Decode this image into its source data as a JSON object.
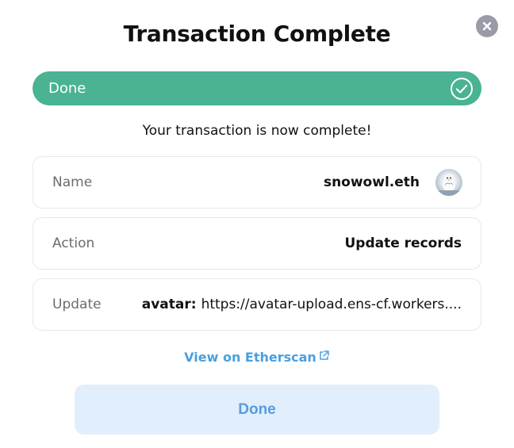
{
  "modal": {
    "title": "Transaction Complete",
    "status_label": "Done",
    "status_color": "#49b393",
    "subtitle": "Your transaction is now complete!"
  },
  "details": {
    "name": {
      "label": "Name",
      "value": "snowowl.eth",
      "icon": "owl-avatar"
    },
    "action": {
      "label": "Action",
      "value": "Update records"
    },
    "update": {
      "label": "Update",
      "key": "avatar:",
      "value": "https://avatar-upload.ens-cf.workers...."
    }
  },
  "links": {
    "etherscan": "View on Etherscan",
    "etherscan_icon": "external-link-icon",
    "color": "#4a9fe0"
  },
  "footer": {
    "done_label": "Done",
    "done_bg": "#e1eefc"
  },
  "icons": {
    "close": "close-icon",
    "check": "check-circle-icon"
  }
}
